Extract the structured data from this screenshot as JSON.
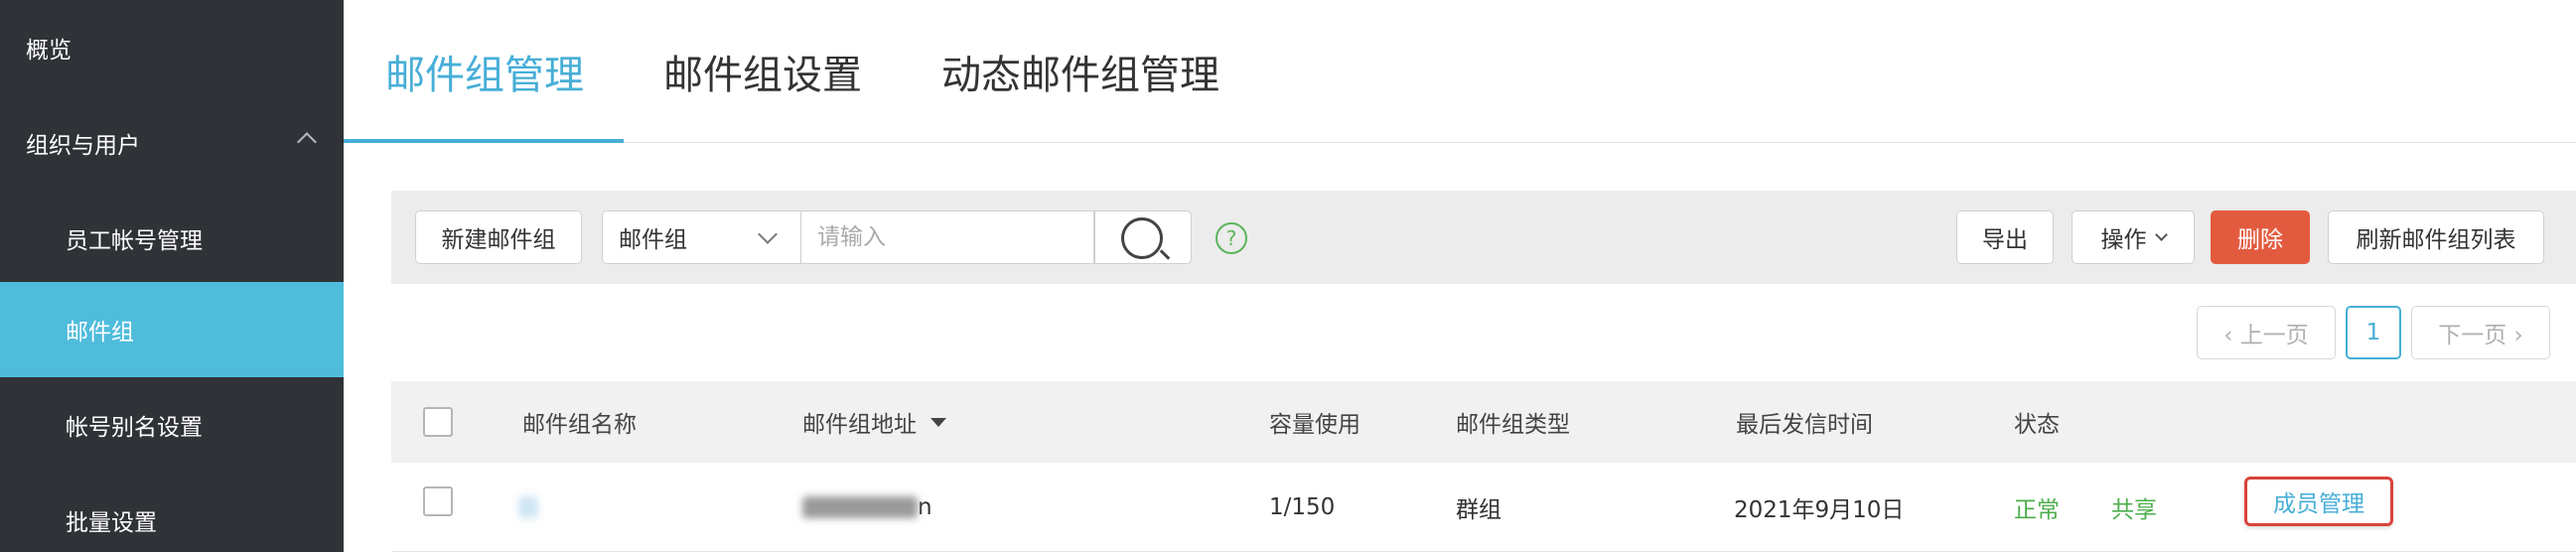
{
  "sidebar": {
    "items": [
      {
        "label": "概览"
      },
      {
        "label": "组织与用户"
      },
      {
        "label": "员工帐号管理"
      },
      {
        "label": "邮件组"
      },
      {
        "label": "帐号别名设置"
      },
      {
        "label": "批量设置"
      }
    ]
  },
  "tabs": [
    {
      "label": "邮件组管理",
      "active": true
    },
    {
      "label": "邮件组设置"
    },
    {
      "label": "动态邮件组管理"
    }
  ],
  "toolbar": {
    "new_group": "新建邮件组",
    "filter_select": "邮件组",
    "search_placeholder": "请输入",
    "help": "?",
    "export": "导出",
    "operations": "操作",
    "delete": "删除",
    "refresh": "刷新邮件组列表"
  },
  "pagination": {
    "prev": "‹ 上一页",
    "current_page": "1",
    "next": "下一页 ›"
  },
  "table": {
    "columns": [
      "邮件组名称",
      "邮件组地址",
      "容量使用",
      "邮件组类型",
      "最后发信时间",
      "状态"
    ],
    "rows": [
      {
        "name": "",
        "address_visible": "n",
        "capacity": "1/150",
        "type": "群组",
        "last_sent": "2021年9月10日",
        "status": "正常",
        "shared": "共享",
        "action": "成员管理"
      }
    ]
  },
  "colors": {
    "sidebar_bg": "#2f3237",
    "accent": "#47aed7",
    "active_item": "#4fbcdc",
    "danger": "#e35b3f",
    "status_green": "#4cae4c"
  }
}
